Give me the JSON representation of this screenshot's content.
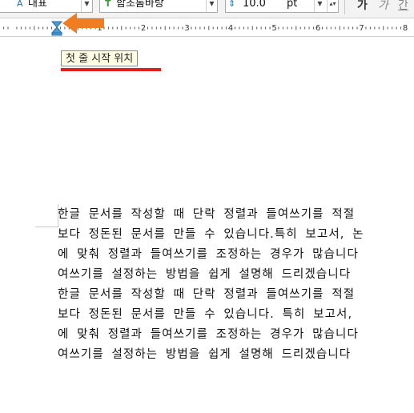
{
  "toolbar": {
    "style_value": "대표",
    "font_value": "함초롬바탕",
    "font_size_value": "10.0",
    "unit_value": "pt",
    "bold_glyph": "가",
    "italic_glyph": "가",
    "underline_glyph": "간"
  },
  "ruler": {
    "numbers": [
      "1",
      "2",
      "3",
      "4",
      "5",
      "6",
      "7",
      "8"
    ]
  },
  "tooltip": {
    "text": "첫 줄 시작 위치"
  },
  "colors": {
    "arrow": "#f07d22",
    "underline": "#e0201f",
    "marker": "#4a9bd6"
  },
  "document": {
    "lines": [
      "한글 문서를 작성할 때 단락 정렬과 들여쓰기를 적절",
      "보다 정돈된 문서를 만들 수 있습니다.특히 보고서, 논",
      "에 맞춰 정렬과 들여쓰기를 조정하는 경우가 많습니다",
      "여쓰기를 설정하는 방법을 쉽게 설명해 드리겠습니다",
      "한글 문서를 작성할 때 단락 정렬과 들여쓰기를 적절",
      "보다 정돈된 문서를 만들 수 있습니다. 특히 보고서,",
      "에 맞춰 정렬과 들여쓰기를 조정하는 경우가 많습니다",
      "여쓰기를 설정하는 방법을 쉽게 설명해 드리겠습니다"
    ]
  }
}
